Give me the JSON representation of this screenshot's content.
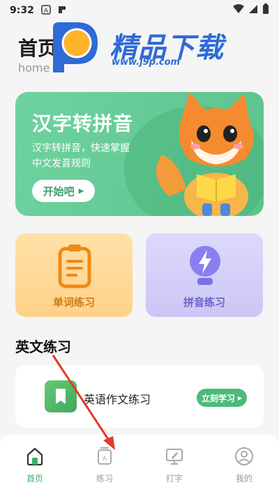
{
  "status_bar": {
    "time": "9:32",
    "left_icons": [
      "a-box-icon",
      "tooltip-cn-icon"
    ],
    "right_icons": [
      "wifi-icon",
      "signal-icon",
      "battery-icon"
    ]
  },
  "header": {
    "title": "首页",
    "subtitle": "home"
  },
  "watermark": {
    "title": "精品下载",
    "url": "www.j9p.com"
  },
  "banner": {
    "title": "汉字转拼音",
    "desc_line1": "汉字转拼音，快速掌握",
    "desc_line2": "中文发音规则",
    "button_label": "开始吧",
    "colors": {
      "bg": "#5cc28d",
      "button_text": "#3f9d6a"
    }
  },
  "cards": [
    {
      "label": "单词练习",
      "icon": "clipboard-icon",
      "color": "#d07a14"
    },
    {
      "label": "拼音练习",
      "icon": "lightbulb-bolt-icon",
      "color": "#6b62c8"
    }
  ],
  "section": {
    "title": "英文练习"
  },
  "list": [
    {
      "title": "英语作文练习",
      "button_label": "立刻学习",
      "icon": "bookmark-icon"
    }
  ],
  "tabbar": {
    "active_color": "#3fae6a",
    "items": [
      {
        "label": "首页",
        "icon": "home-icon",
        "active": true
      },
      {
        "label": "练习",
        "icon": "practice-book-icon",
        "active": false
      },
      {
        "label": "打字",
        "icon": "typing-icon",
        "active": false
      },
      {
        "label": "我的",
        "icon": "profile-icon",
        "active": false
      }
    ]
  }
}
